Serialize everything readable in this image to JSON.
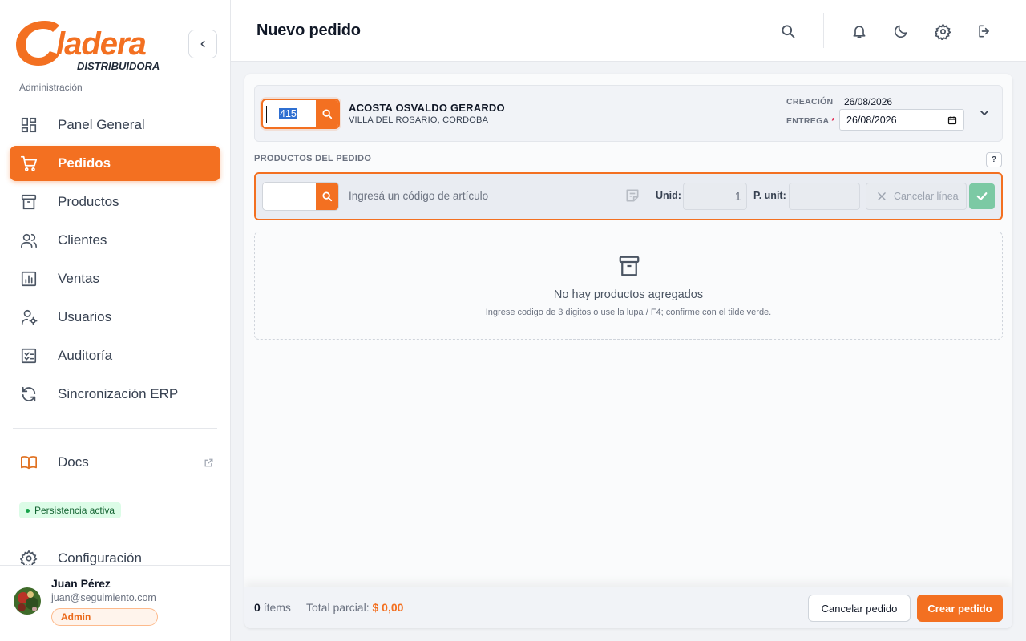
{
  "brand": {
    "logo_text": "Gladera",
    "logo_subtitle": "DISTRIBUIDORA",
    "accent_color": "#f37021"
  },
  "sidebar": {
    "section_label": "Administración",
    "items": [
      {
        "label": "Panel General",
        "icon": "dashboard-icon"
      },
      {
        "label": "Pedidos",
        "icon": "cart-icon",
        "active": true
      },
      {
        "label": "Productos",
        "icon": "archive-icon"
      },
      {
        "label": "Clientes",
        "icon": "users-icon"
      },
      {
        "label": "Ventas",
        "icon": "chart-icon"
      },
      {
        "label": "Usuarios",
        "icon": "user-gear-icon"
      },
      {
        "label": "Auditoría",
        "icon": "checklist-icon"
      },
      {
        "label": "Sincronización ERP",
        "icon": "sync-icon"
      }
    ],
    "docs_label": "Docs",
    "persistence_badge": "Persistencia activa",
    "config_label": "Configuración"
  },
  "user": {
    "name": "Juan Pérez",
    "email": "juan@seguimiento.com",
    "role": "Admin"
  },
  "header": {
    "title": "Nuevo pedido",
    "icons": [
      "search-icon",
      "bell-icon",
      "moon-icon",
      "gear-icon",
      "logout-icon"
    ]
  },
  "client": {
    "code": "415",
    "name": "ACOSTA OSVALDO GERARDO",
    "location": "VILLA DEL ROSARIO, CORDOBA",
    "creation_label": "CREACIÓN",
    "creation_date": "26/08/2026",
    "delivery_label": "ENTREGA",
    "delivery_required": "*",
    "delivery_date": "26/08/2026"
  },
  "products": {
    "section_title": "PRODUCTOS DEL PEDIDO",
    "help": "?",
    "entry": {
      "code_placeholder": "Ingresá un código de artículo",
      "unid_label": "Unid:",
      "unid_value": "1",
      "punit_label": "P. unit:",
      "punit_value": "",
      "cancel_line": "Cancelar línea"
    },
    "empty_title": "No hay productos agregados",
    "empty_hint": "Ingrese codigo de 3 digitos o use la lupa / F4; confirme con el tilde verde."
  },
  "footer": {
    "items_count": "0",
    "items_label": "ítems",
    "total_label": "Total parcial:",
    "total_value": "$ 0,00",
    "cancel_order": "Cancelar pedido",
    "create_order": "Crear pedido"
  }
}
